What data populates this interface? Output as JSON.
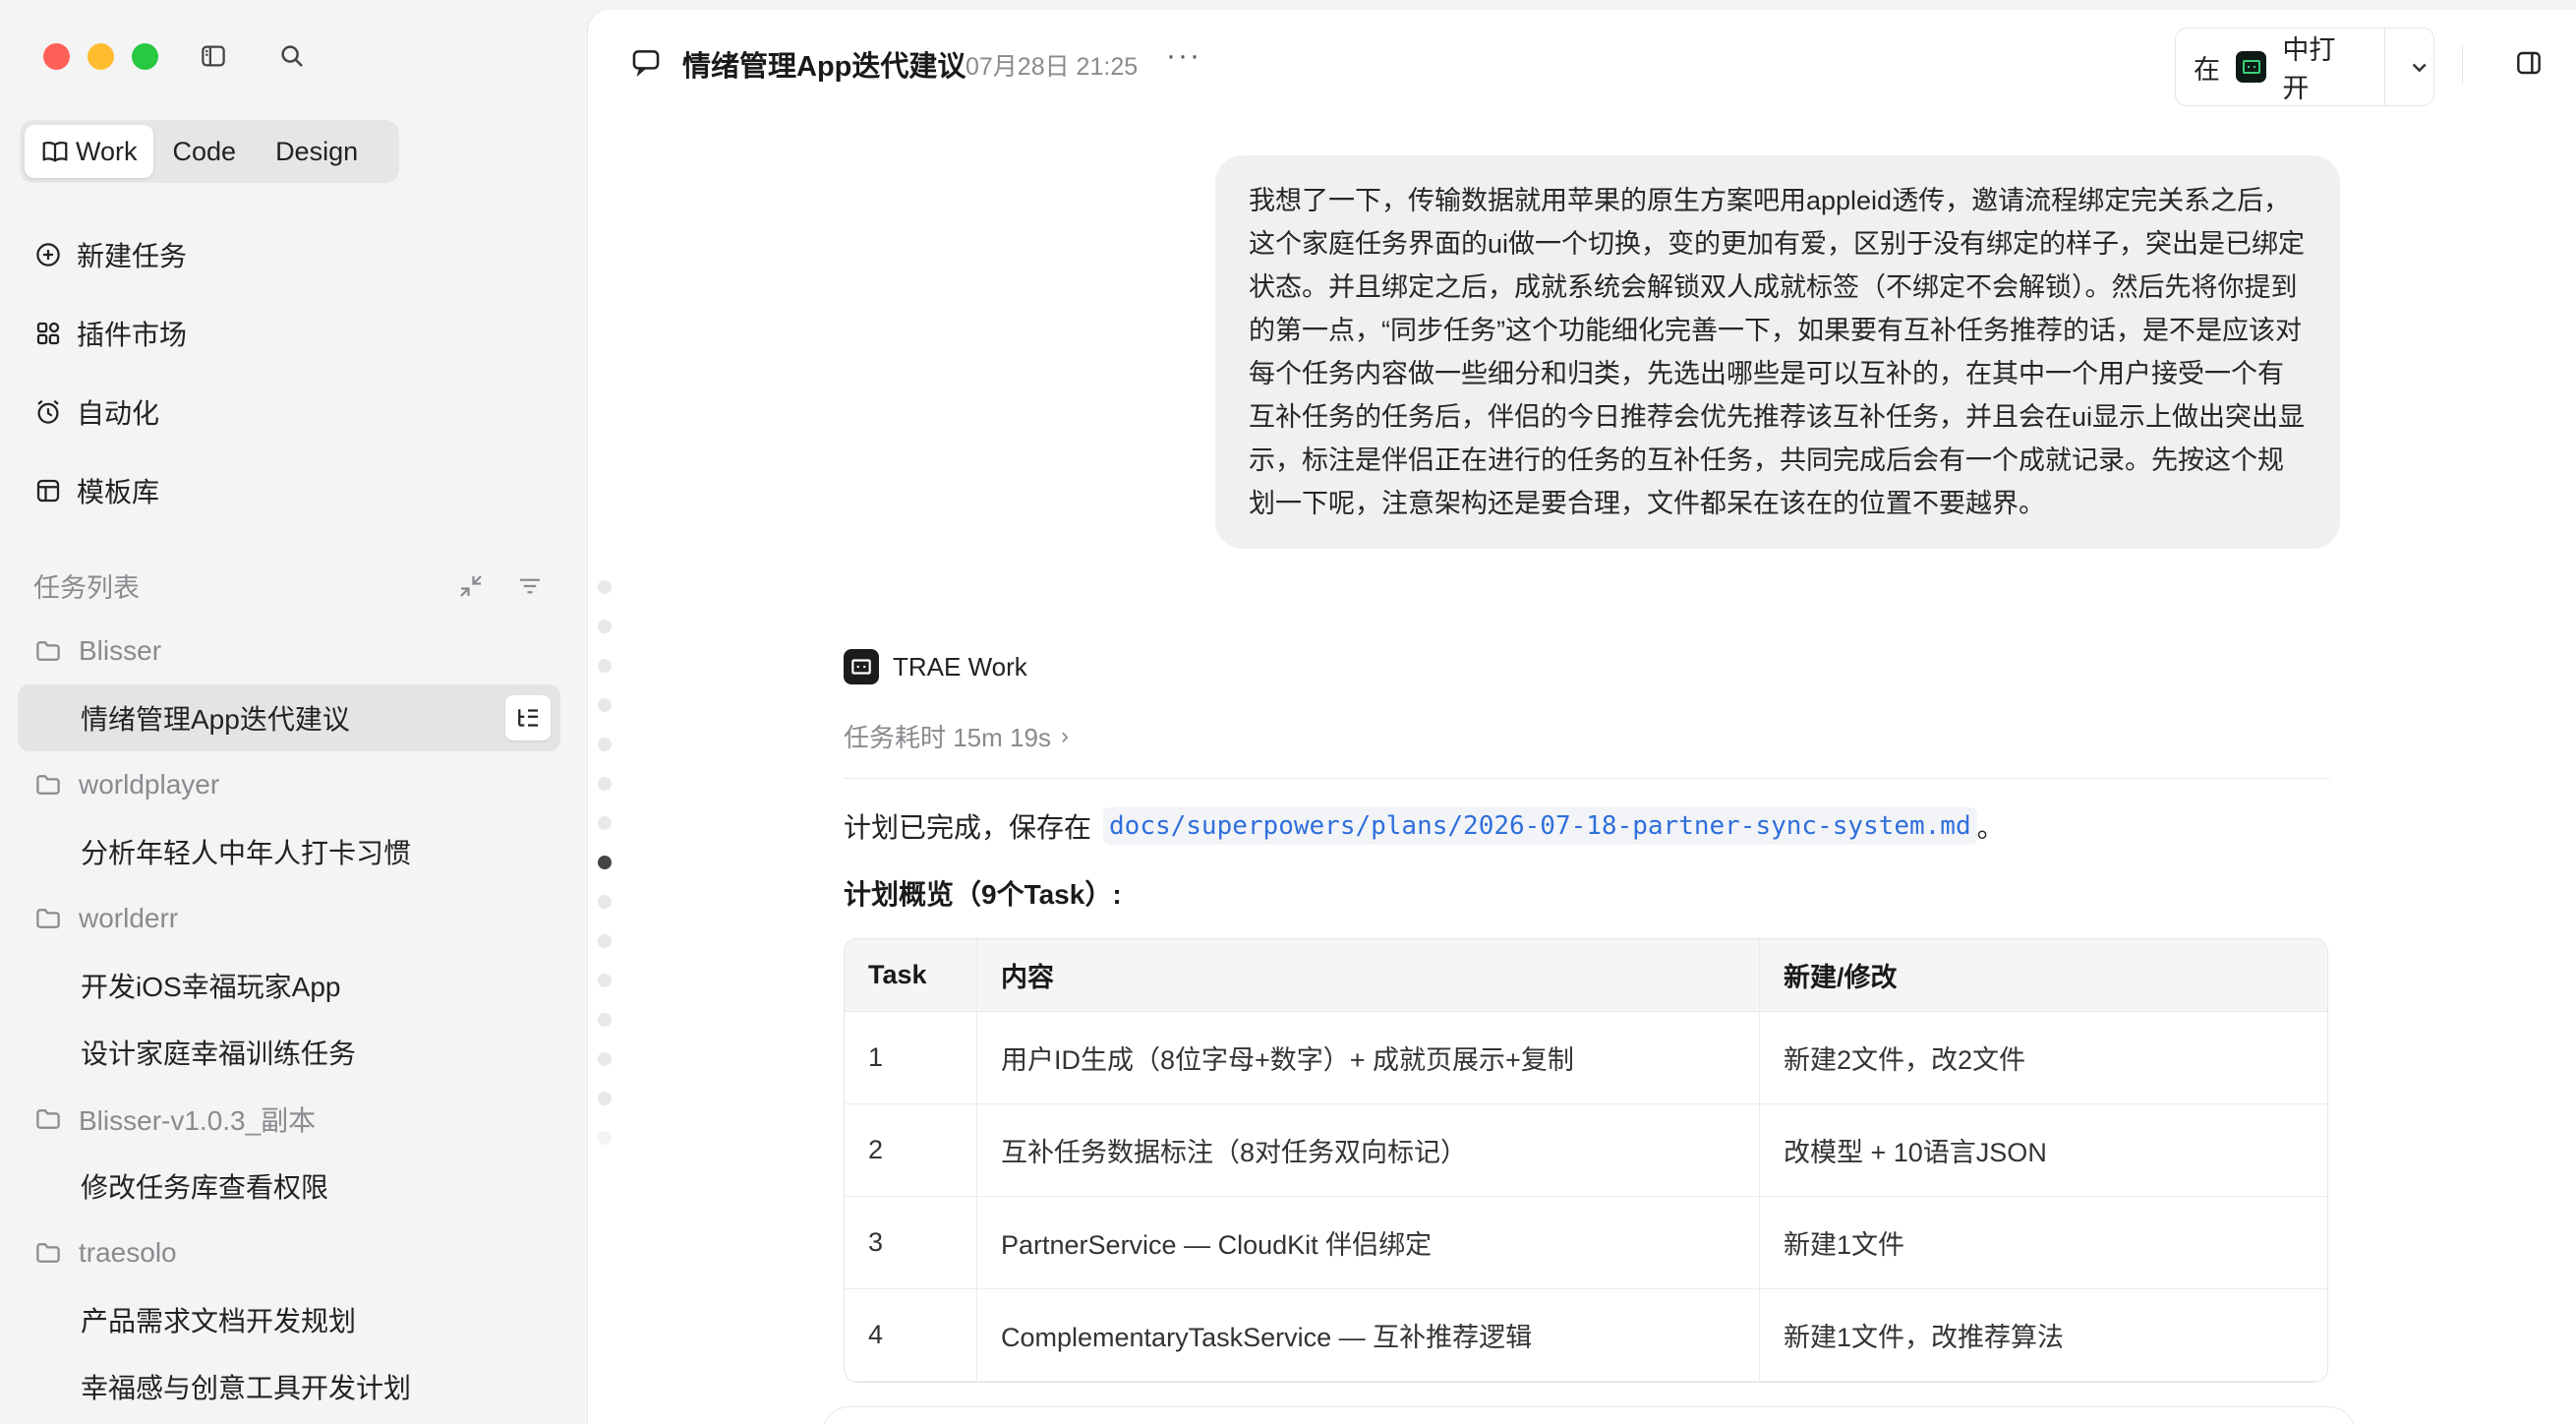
{
  "sidebar": {
    "modes": [
      {
        "label": "Work",
        "active": true
      },
      {
        "label": "Code",
        "active": false
      },
      {
        "label": "Design",
        "active": false
      }
    ],
    "nav": [
      {
        "label": "新建任务",
        "icon": "plus-circle-icon"
      },
      {
        "label": "插件市场",
        "icon": "grid-icon"
      },
      {
        "label": "自动化",
        "icon": "alarm-clock-icon"
      },
      {
        "label": "模板库",
        "icon": "template-icon"
      }
    ],
    "section_title": "任务列表",
    "groups": [
      {
        "folder": "Blisser",
        "tasks": [
          "情绪管理App迭代建议"
        ]
      },
      {
        "folder": "worldplayer",
        "tasks": [
          "分析年轻人中年人打卡习惯"
        ]
      },
      {
        "folder": "worlderr",
        "tasks": [
          "开发iOS幸福玩家App",
          "设计家庭幸福训练任务"
        ]
      },
      {
        "folder": "Blisser-v1.0.3_副本",
        "tasks": [
          "修改任务库查看权限"
        ]
      },
      {
        "folder": "traesolo",
        "tasks": [
          "产品需求文档开发规划",
          "幸福感与创意工具开发计划"
        ]
      }
    ],
    "active_task": "情绪管理App迭代建议"
  },
  "header": {
    "title": "情绪管理App迭代建议",
    "time": "07月28日 21:25",
    "more": "···",
    "open_in_prefix": "在",
    "open_in_label": "中打开"
  },
  "user_message": "我想了一下，传输数据就用苹果的原生方案吧用appleid透传，邀请流程绑定完关系之后，这个家庭任务界面的ui做一个切换，变的更加有爱，区别于没有绑定的样子，突出是已绑定状态。并且绑定之后，成就系统会解锁双人成就标签（不绑定不会解锁）。然后先将你提到的第一点，“同步任务”这个功能细化完善一下，如果要有互补任务推荐的话，是不是应该对每个任务内容做一些细分和归类，先选出哪些是可以互补的，在其中一个用户接受一个有互补任务的任务后，伴侣的今日推荐会优先推荐该互补任务，并且会在ui显示上做出突出显示，标注是伴侣正在进行的任务的互补任务，共同完成后会有一个成就记录。先按这个规划一下呢，注意架构还是要合理，文件都呆在该在的位置不要越界。",
  "assistant": {
    "name": "TRAE Work",
    "duration": "任务耗时 15m 19s",
    "done_prefix": "计划已完成，保存在",
    "done_path": "docs/superpowers/plans/2026-07-18-partner-sync-system.md",
    "done_suffix": "。",
    "overview": "计划概览（9个Task）:",
    "table": {
      "headers": [
        "Task",
        "内容",
        "新建/修改"
      ],
      "rows": [
        [
          "1",
          "用户ID生成（8位字母+数字）+ 成就页展示+复制",
          "新建2文件，改2文件"
        ],
        [
          "2",
          "互补任务数据标注（8对任务双向标记）",
          "改模型 + 10语言JSON"
        ],
        [
          "3",
          "PartnerService — CloudKit 伴侣绑定",
          "新建1文件"
        ],
        [
          "4",
          "ComplementaryTaskService — 互补推荐逻辑",
          "新建1文件，改推荐算法"
        ]
      ]
    }
  },
  "colors": {
    "accent_link": "#2f6fdc",
    "sidebar_bg": "#f4f4f5",
    "bubble_bg": "#f0f0f2"
  }
}
